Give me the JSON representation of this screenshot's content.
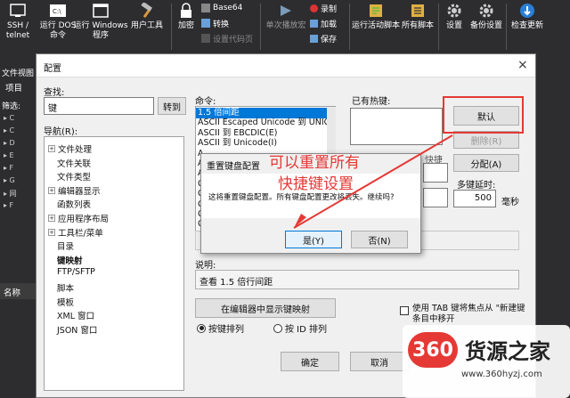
{
  "ribbon": {
    "buttons": [
      {
        "label": "SSH /\ntelnet",
        "icon": "terminal-icon"
      },
      {
        "label": "运行 DOS\n命令",
        "icon": "console-icon"
      },
      {
        "label": "运行 Windows\n程序",
        "icon": "window-icon"
      },
      {
        "label": "用户工具",
        "icon": "hammer-icon"
      },
      {
        "label": "加密",
        "icon": "lock-icon"
      },
      {
        "label": "单次播放宏",
        "icon": "play-macro-icon"
      },
      {
        "label": "运行活动脚本",
        "icon": "script-icon"
      },
      {
        "label": "所有脚本",
        "icon": "scripts-icon"
      },
      {
        "label": "设置",
        "icon": "gear-icon"
      },
      {
        "label": "备份设置",
        "icon": "gear-backup-icon"
      },
      {
        "label": "检查更新",
        "icon": "globe-icon"
      }
    ],
    "small": [
      {
        "label": "Base64",
        "icon": "base64-icon"
      },
      {
        "label": "转换",
        "icon": "convert-icon"
      },
      {
        "label": "设置代码页",
        "icon": "codepage-icon"
      },
      {
        "label": "录制",
        "icon": "record-icon"
      },
      {
        "label": "加载",
        "icon": "load-icon"
      },
      {
        "label": "保存",
        "icon": "save-icon"
      }
    ]
  },
  "left": {
    "file_view": "文件视图",
    "project": "项目",
    "filter": "筛选:",
    "name": "名称"
  },
  "dialog": {
    "title": "配置",
    "close": "×",
    "find_label": "查找:",
    "find_value": "键",
    "goto_button": "转到",
    "nav_label": "导航(R):",
    "tree": [
      {
        "label": "文件处理",
        "exp": "+",
        "level": 0
      },
      {
        "label": "文件关联",
        "exp": "",
        "level": 1
      },
      {
        "label": "文件类型",
        "exp": "",
        "level": 1
      },
      {
        "label": "编辑器显示",
        "exp": "+",
        "level": 0
      },
      {
        "label": "函数列表",
        "exp": "",
        "level": 1
      },
      {
        "label": "应用程序布局",
        "exp": "+",
        "level": 0
      },
      {
        "label": "工具栏/菜单",
        "exp": "+",
        "level": 0
      },
      {
        "label": "目录",
        "exp": "",
        "level": 1
      },
      {
        "label": "键映射",
        "exp": "",
        "level": 1,
        "bold": true
      },
      {
        "label": "FTP/SFTP",
        "exp": "",
        "level": 1
      },
      {
        "label": "脚本",
        "exp": "",
        "level": 1
      },
      {
        "label": "模板",
        "exp": "",
        "level": 1
      },
      {
        "label": "XML 窗口",
        "exp": "",
        "level": 1
      },
      {
        "label": "JSON 窗口",
        "exp": "",
        "level": 1
      }
    ],
    "command_label": "命令:",
    "commands": [
      "1.5 倍间距",
      "ASCII Escaped Unicode 到 UNICOD",
      "ASCII 到 EBCDIC(E)",
      "ASCII 到 Unicode(I)",
      "A",
      "A",
      "A",
      "C",
      "C",
      "C",
      "C",
      "C",
      "C"
    ],
    "hotkeys_label": "已有热键:",
    "default_button": "默认",
    "delete_button": "删除(R)",
    "assign_button": "分配(A)",
    "shortcut_label": "快捷",
    "multikey_label": "多键延时:",
    "multikey_value": "500",
    "ms_label": "毫秒",
    "desc_label": "说明:",
    "desc_value": "查看 1.5 倍行间距",
    "show_in_editor_button": "在编辑器中显示键映射",
    "sort_by_key": "按键排列",
    "sort_by_id": "按 ID 排列",
    "tab_checkbox_label": "使用 TAB 键将焦点从 \"新建键\n条目中移开",
    "ok_button": "确定",
    "cancel_button": "取消"
  },
  "confirm": {
    "title": "重置键盘配置",
    "message": "这将重置键盘配置。所有键盘配置更改将丢失。继续吗?",
    "yes": "是(Y)",
    "no": "否(N)"
  },
  "annotation": {
    "line1": "可以重置所有",
    "line2": "快捷键设置",
    "color": "#e53935"
  },
  "watermark": {
    "logo": "360",
    "brand": "货源之家",
    "url": "www.360hyzj.com"
  },
  "colors": {
    "selection": "#0078d7",
    "ribbon_bg": "#2d2d30",
    "accent_red": "#e53935"
  }
}
